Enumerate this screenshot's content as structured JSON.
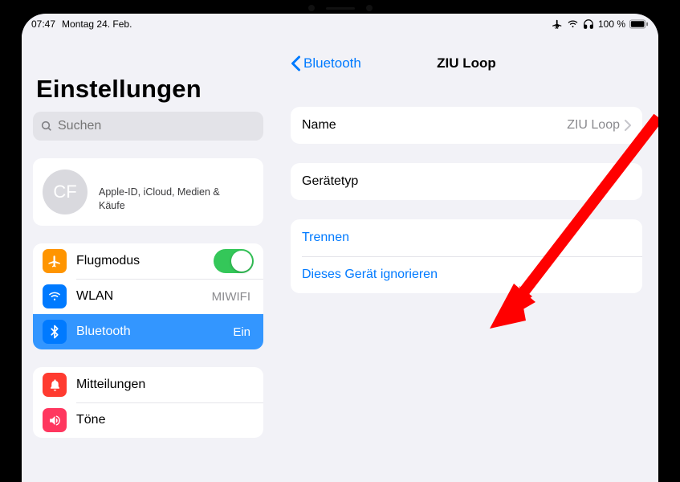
{
  "status": {
    "time": "07:47",
    "date": "Montag 24. Feb.",
    "battery_pct": "100 %"
  },
  "sidebar": {
    "title": "Einstellungen",
    "search_placeholder": "Suchen",
    "account": {
      "initials": "CF",
      "subtitle": "Apple-ID, iCloud, Medien & Käufe"
    },
    "rows": {
      "airplane": {
        "label": "Flugmodus"
      },
      "wlan": {
        "label": "WLAN",
        "value": "MIWIFI"
      },
      "bluetooth": {
        "label": "Bluetooth",
        "value": "Ein"
      },
      "notifications": {
        "label": "Mitteilungen"
      },
      "sounds": {
        "label": "Töne"
      }
    }
  },
  "detail": {
    "back_label": "Bluetooth",
    "title": "ZIU Loop",
    "name_label": "Name",
    "name_value": "ZIU Loop",
    "type_label": "Gerätetyp",
    "disconnect": "Trennen",
    "forget": "Dieses Gerät ignorieren"
  },
  "colors": {
    "ios_blue": "#007aff",
    "ios_green": "#34c759",
    "ios_orange": "#ff9500",
    "ios_red": "#ff3b30",
    "arrow_red": "#ff0000"
  }
}
